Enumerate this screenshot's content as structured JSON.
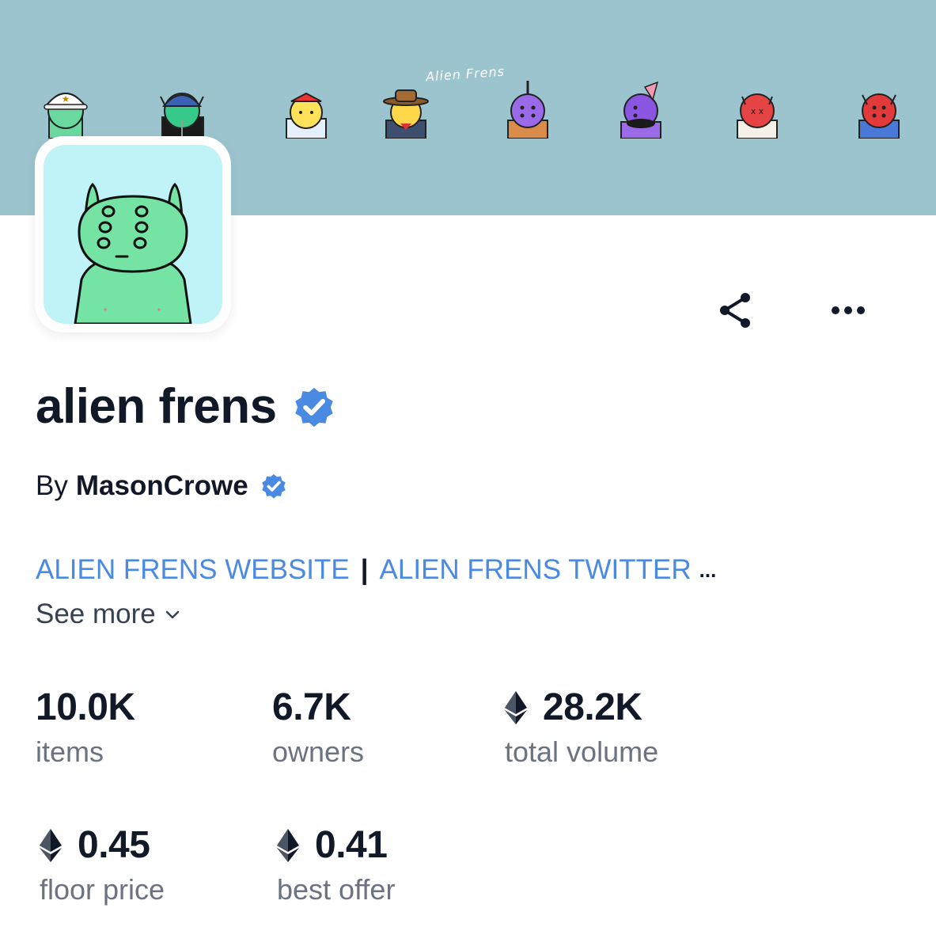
{
  "banner": {
    "title": "Alien Frens"
  },
  "collection": {
    "name": "alien frens",
    "by_label": "By",
    "creator": "MasonCrowe",
    "verified_color": "#4a8ae3"
  },
  "links": {
    "website": "ALIEN FRENS WEBSITE",
    "separator": "|",
    "twitter": "ALIEN FRENS TWITTER",
    "ellipsis": "..."
  },
  "see_more": "See more",
  "stats": [
    {
      "value": "10.0K",
      "label": "items",
      "eth": false
    },
    {
      "value": "6.7K",
      "label": "owners",
      "eth": false
    },
    {
      "value": "28.2K",
      "label": "total volume",
      "eth": true
    },
    {
      "value": "0.45",
      "label": "floor price",
      "eth": true
    },
    {
      "value": "0.41",
      "label": "best offer",
      "eth": true
    }
  ],
  "icons": {
    "share": "share-icon",
    "more": "more-horizontal-icon",
    "verified": "verified-badge-icon",
    "eth": "ethereum-icon",
    "chevron": "chevron-down-icon"
  }
}
